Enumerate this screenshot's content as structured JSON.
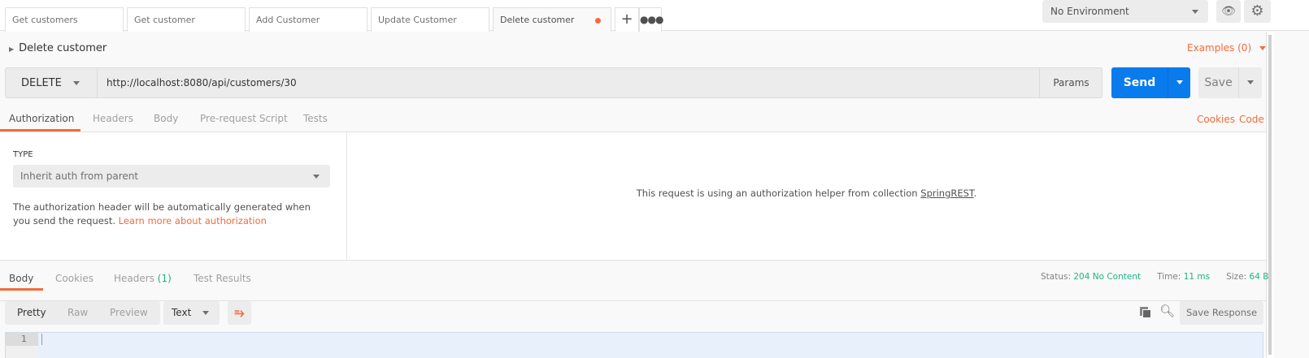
{
  "tabs": [
    {
      "label": "Get customers"
    },
    {
      "label": "Get customer"
    },
    {
      "label": "Add Customer"
    },
    {
      "label": "Update Customer"
    },
    {
      "label": "Delete customer",
      "unsaved": true
    }
  ],
  "environment": {
    "selected": "No Environment"
  },
  "request": {
    "name": "Delete customer",
    "examples": "Examples (0)",
    "method": "DELETE",
    "url": "http://localhost:8080/api/customers/30",
    "params": "Params",
    "send": "Send",
    "save": "Save"
  },
  "request_tabs": [
    "Authorization",
    "Headers",
    "Body",
    "Pre-request Script",
    "Tests"
  ],
  "links": {
    "cookies": "Cookies",
    "code": "Code"
  },
  "auth": {
    "type_label": "TYPE",
    "type_value": "Inherit auth from parent",
    "desc": "The authorization header will be automatically generated when you send the request. ",
    "learn_more": "Learn more about authorization",
    "helper_text": "This request is using an authorization helper from collection ",
    "collection": "SpringREST",
    "period": "."
  },
  "response_tabs": {
    "body": "Body",
    "cookies": "Cookies",
    "headers": "Headers",
    "headers_count": "(1)",
    "tests": "Test Results"
  },
  "status": {
    "status_label": "Status:",
    "status": "204 No Content",
    "time_label": "Time:",
    "time": "11 ms",
    "size_label": "Size:",
    "size": "64 B"
  },
  "view": {
    "pretty": "Pretty",
    "raw": "Raw",
    "preview": "Preview",
    "format": "Text",
    "save_response": "Save Response"
  },
  "editor": {
    "line": "1"
  },
  "colors": {
    "accent": "#f26b3a",
    "send": "#097bed",
    "success": "#1fb286"
  }
}
